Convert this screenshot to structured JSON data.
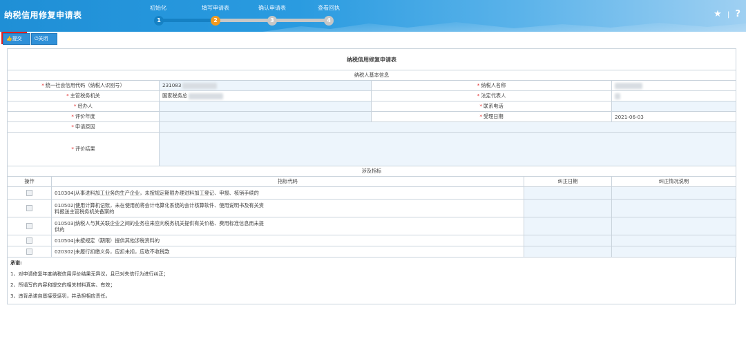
{
  "header": {
    "title": "纳税信用修复申请表",
    "steps": [
      {
        "num": "1",
        "label": "初始化",
        "color": "#1581c4"
      },
      {
        "num": "2",
        "label": "填写申请表",
        "color": "#f39a1e"
      },
      {
        "num": "3",
        "label": "确认申请表",
        "color": "#c7c7c7"
      },
      {
        "num": "4",
        "label": "查看回执",
        "color": "#c7c7c7"
      }
    ],
    "current_step": 2,
    "star_icon": "★",
    "help_icon": "?",
    "sep": "|"
  },
  "toolbar": {
    "submit_label": "提交",
    "submit_icon": "👍",
    "close_label": "关闭",
    "close_icon": "⏻"
  },
  "form": {
    "title": "纳税信用修复申请表",
    "basic_section": "纳税人基本信息",
    "fields": {
      "credit_code_label": "统一社会信用代码（纳税人识别号）",
      "credit_code_value": "231083",
      "taxpayer_name_label": "纳税人名称",
      "tax_authority_label": "主管税务机关",
      "tax_authority_value": "国家税务总",
      "legal_rep_label": "法定代表人",
      "handler_label": "经办人",
      "phone_label": "联系电话",
      "eval_year_label": "评价年度",
      "accept_date_label": "受理日期",
      "accept_date_value": "2021-06-03",
      "reason_label": "申请原因",
      "result_label": "评价结果"
    },
    "indicators_section": "涉及指标",
    "indicator_headers": [
      "操作",
      "指标代码",
      "纠正日期",
      "纠正情况说明"
    ],
    "indicators": [
      {
        "text": "010304|从事进料加工业务的生产企业，未按规定期限办理进料加工登记、申报、核销手续的"
      },
      {
        "text": "010502|使用计算机记账，未在使用前将会计电算化系统的会计核算软件、使用说明书及有关资料报送主管税务机关备案的"
      },
      {
        "text": "010503|纳税人与其关联企业之间的业务往来应向税务机关提供有关价格、费用标准信息而未提供的"
      },
      {
        "text": "010504|未按规定（期限）提供其他涉税资料的"
      },
      {
        "text": "020302|未履行扣缴义务，应扣未扣，应收不收税款"
      }
    ],
    "promise": {
      "heading": "承诺:",
      "items": [
        "1、对申请修复年度纳税信用评价结果无异议，且已对失信行为进行纠正；",
        "2、所填写的内容和提交的相关材料真实、有效；",
        "3、违背承诺自愿接受惩罚，并承担相应责任。"
      ]
    },
    "required_mark": "*"
  }
}
